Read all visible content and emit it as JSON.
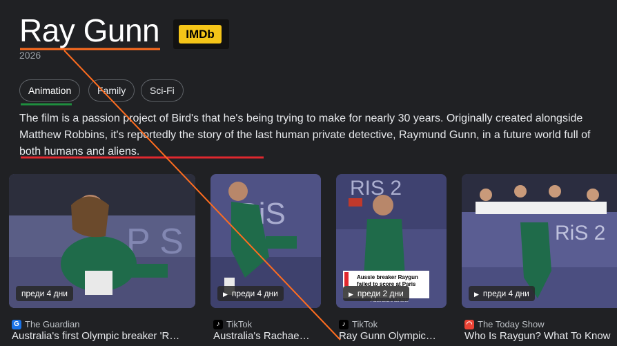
{
  "header": {
    "title": "Ray Gunn",
    "imdb_label": "IMDb",
    "year": "2026"
  },
  "genres": [
    {
      "label": "Animation",
      "selected": true
    },
    {
      "label": "Family",
      "selected": false
    },
    {
      "label": "Sci-Fi",
      "selected": false
    }
  ],
  "description": {
    "text": "The film is a passion project of Bird's that he's being trying to make for nearly 30 years. Originally created alongside Matthew Robbins, it's reportedly the story of the last human private detective, Raymund Gunn, in a future world full of both humans and aliens."
  },
  "cards": [
    {
      "badge": "преди 4 дни",
      "video": false,
      "source": "The Guardian",
      "source_icon": "guardian-icon",
      "headline": "Australia's first Olympic breaker 'R…"
    },
    {
      "badge": "преди 4 дни",
      "video": true,
      "source": "TikTok",
      "source_icon": "tiktok-icon",
      "headline": "Australia's Rachae…"
    },
    {
      "badge": "преди 2 дни",
      "video": true,
      "source": "TikTok",
      "source_icon": "tiktok-icon",
      "headline": "Ray Gunn Olympic…",
      "caption": "Aussie breaker Raygun failed to score at Paris",
      "caption_sub": "Australia's athlete"
    },
    {
      "badge": "преди 4 дни",
      "video": true,
      "source": "The Today Show",
      "source_icon": "today-show-icon",
      "headline": "Who Is Raygun? What To Know"
    }
  ],
  "colors": {
    "background": "#202124",
    "title_underline": "#ff6d1f",
    "selected_chip_underline": "#1e8e3e",
    "description_underline": "#e0282e",
    "imdb_yellow": "#f5c518"
  }
}
